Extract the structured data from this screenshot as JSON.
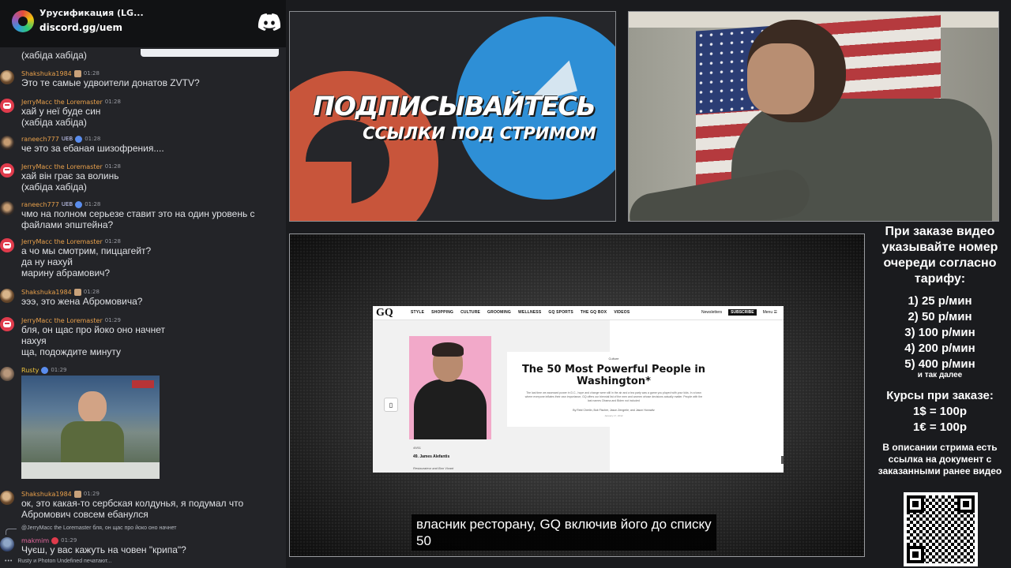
{
  "discord": {
    "server_name": "Урусификация (LG...",
    "invite": "discord.gg/uem"
  },
  "chat": {
    "top_partial": "(хабіда хабіда)",
    "messages": [
      {
        "user": "Shakshuka1984",
        "time": "01:28",
        "text": "Это те самые удвоители донатов ZVTV?"
      },
      {
        "user": "JerryMacc the Loremaster",
        "time": "01:28",
        "text": "хай у неї буде син\n(хабіда хабіда)"
      },
      {
        "user": "raneech777",
        "badge": "UEB",
        "time": "01:28",
        "text": "че это за ебаная шизофрения...."
      },
      {
        "user": "JerryMacc the Loremaster",
        "time": "01:28",
        "text": "хай він грає за волинь\n(хабіда хабіда)"
      },
      {
        "user": "raneech777",
        "badge": "UEB",
        "time": "01:28",
        "text": "чмо на полном серьезе ставит это на один уровень с\nфайлами эпштейна?"
      },
      {
        "user": "JerryMacc the Loremaster",
        "time": "01:28",
        "text": "а чо мы смотрим, пиццагейт?\nда ну нахуй\nмарину абрамович?"
      },
      {
        "user": "Shakshuka1984",
        "time": "01:28",
        "text": "эээ, это жена Абромовича?"
      },
      {
        "user": "JerryMacc the Loremaster",
        "time": "01:29",
        "text": "бля, он щас про йоко оно начнет\nнахуя\nща, подождите минуту"
      },
      {
        "user": "Rusty",
        "time": "01:29",
        "text": ""
      },
      {
        "user": "Shakshuka1984",
        "time": "01:29",
        "text": "ок, это какая-то сербская колдунья, я подумал что\nАбромович совсем ебанулся"
      },
      {
        "user": "makmim",
        "time": "01:29",
        "text": "Чуєш, у вас кажуть на човен \"крипа\"?"
      }
    ],
    "reply_preview": "@JerryMacc the Loremaster  бля, он щас про йоко оно начнет",
    "typing": "Rusty и Photon Undefined печатают..."
  },
  "promo": {
    "title": "ПОДПИСЫВАЙТЕСЬ",
    "subtitle": "ССЫЛКИ ПОД СТРИМОМ",
    "colors": {
      "patreon": "#c8553b",
      "telegram": "#2e8fd6"
    }
  },
  "video": {
    "gq": {
      "logo": "GQ",
      "nav": [
        "STYLE",
        "SHOPPING",
        "CULTURE",
        "GROOMING",
        "WELLNESS",
        "GQ SPORTS",
        "THE GQ BOX",
        "VIDEOS"
      ],
      "newsletters": "Newsletters",
      "subscribe": "SUBSCRIBE",
      "menu": "Menu ☰",
      "category": "Culture",
      "headline": "The 50 Most Powerful People in Washington*",
      "dek": "The last time we assessed power in D.C., hope and change were still in the air and a tea party was a game you played with your kids. In a town where everyone inflates their own importance, GQ offers our biennial list of the men and women whose decisions actually matter. People with the last names Obama and Biden not included",
      "byline": "By Reid Cherlin, Bob Fischer, Jason Zengerle, and Jason Horowitz",
      "date": "January 17, 2012",
      "rank": "49/51",
      "entry": "49. James Alefantis",
      "entry_role": "Restaurateur and Bon Vivant"
    },
    "subtitle_line1": "власник ресторану, GQ включив його до списку",
    "subtitle_line2": "50"
  },
  "info": {
    "heading": "При заказе видео указывайте номер очереди согласно тарифу:",
    "prices": [
      "1) 25 р/мин",
      "2) 50 р/мин",
      "3) 100 р/мин",
      "4) 200 р/мин",
      "5) 400 р/мин"
    ],
    "etc": "и так далее",
    "courses_title": "Курсы при заказе:",
    "courses": [
      "1$ = 100р",
      "1€ = 100р"
    ],
    "description": "В описании стрима есть ссылка на документ с заказанными ранее видео"
  }
}
